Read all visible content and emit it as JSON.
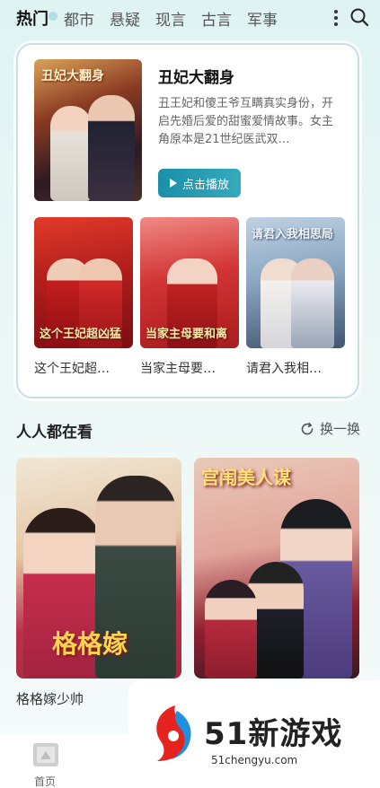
{
  "tabs": [
    {
      "label": "热门",
      "active": true
    },
    {
      "label": "都市",
      "active": false
    },
    {
      "label": "悬疑",
      "active": false
    },
    {
      "label": "现言",
      "active": false
    },
    {
      "label": "古言",
      "active": false
    },
    {
      "label": "军事",
      "active": false
    }
  ],
  "feature": {
    "poster_text": "丑妃大翻身",
    "title": "丑妃大翻身",
    "description": "丑王妃和傻王爷互瞒真实身份，开启先婚后爱的甜蜜爱情故事。女主角原本是21世纪医武双…",
    "play_label": "点击播放",
    "accent": "#1b8fa8"
  },
  "mini_items": [
    {
      "label": "这个王妃超…",
      "poster_text": "这个王妃超凶猛"
    },
    {
      "label": "当家主母要…",
      "poster_text": "当家主母要和离"
    },
    {
      "label": "请君入我相…",
      "poster_text": "请君入我相思局"
    }
  ],
  "section": {
    "title": "人人都在看",
    "refresh_label": "换一换"
  },
  "big_items": [
    {
      "label": "格格嫁少帅",
      "poster_text": "格格嫁"
    },
    {
      "label": "",
      "poster_text": "宫闱美人谋"
    }
  ],
  "watermark": {
    "brand": "51新游戏",
    "url": "51chengyu.com"
  },
  "nav": {
    "home_label": "首页"
  }
}
